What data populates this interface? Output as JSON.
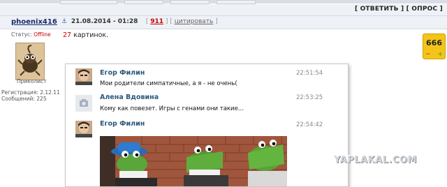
{
  "post_actions": {
    "reply": "[ ОТВЕТИТЬ ]",
    "poll": "[ ОПРОС ]"
  },
  "post": {
    "author": "phoenix416",
    "anchor_icon": "anchor-icon",
    "date": "21.08.2014 - 01:28",
    "post_number": "911",
    "quote_label": "цитировать"
  },
  "author_panel": {
    "status_label": "Статус:",
    "status_value": "Offline",
    "rank": "Приколист",
    "registered": "Регистрация: 2.12.11",
    "messages": "Сообщений: 225"
  },
  "content": {
    "count": "27",
    "text": " картинок."
  },
  "rating": {
    "score": "666",
    "minus": "−",
    "plus": "+"
  },
  "chat": {
    "messages": [
      {
        "name": "Егор Филин",
        "time": "22:51:54",
        "text": "Мои родители симпатичные, а я - не очень("
      },
      {
        "name": "Алена Вдовина",
        "time": "22:53:25",
        "text": "Кому как повезет. Игры с генами они такие..."
      },
      {
        "name": "Егор Филин",
        "time": "22:54:42",
        "text": ""
      }
    ]
  },
  "watermark": "YAPLAKAL.COM"
}
